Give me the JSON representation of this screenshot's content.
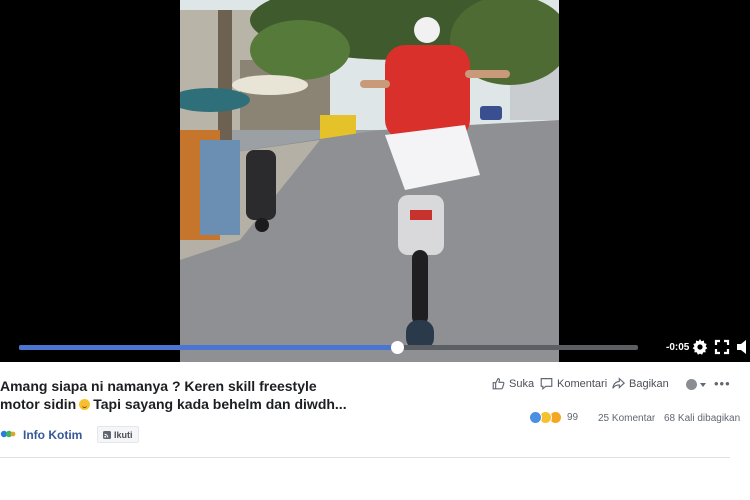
{
  "player": {
    "progress_percent": 61,
    "time_remaining": "-0:05",
    "controls": [
      "gear-icon",
      "fullscreen-icon",
      "volume-icon"
    ],
    "accent_color": "#4a76d1"
  },
  "post": {
    "caption_line1": "Amang siapa ni namanya ? Keren skill freestyle",
    "caption_line2_a": "motor sidin",
    "caption_line2_b": "Tapi sayang kada behelm dan diwdh...",
    "actions": {
      "like_label": "Suka",
      "comment_label": "Komentari",
      "share_label": "Bagikan"
    },
    "stats": {
      "reactions": "99",
      "comments": "25 Komentar",
      "shares": "68 Kali dibagikan"
    },
    "page": {
      "name": "Info Kotim",
      "follow_label": "Ikuti",
      "link_color": "#365899"
    }
  }
}
